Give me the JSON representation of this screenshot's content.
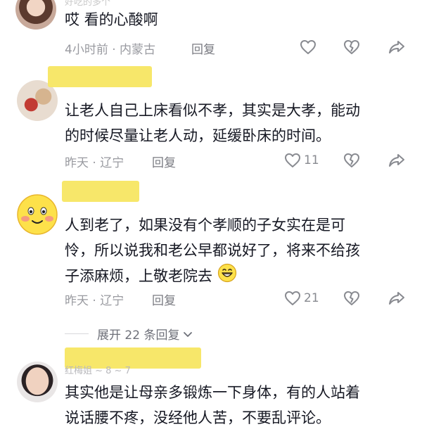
{
  "comments": [
    {
      "name": "好吃的多个",
      "text_lines": [
        "哎  看的心酸啊"
      ],
      "time_location": "4小时前 · 内蒙古",
      "reply_label": "回复",
      "like_count": ""
    },
    {
      "name": "",
      "text_lines": [
        "让老人自己上床看似不孝，其实是大孝，能动",
        "的时候尽量让老人动，延缓卧床的时间。"
      ],
      "time_location": "昨天 · 辽宁",
      "reply_label": "回复",
      "like_count": "11"
    },
    {
      "name": "",
      "text_lines": [
        "人到老了，如果没有个孝顺的子女实在是可",
        "怜，所以说我和老公早都说好了，将来不给孩",
        "子添麻烦，上敬老院去"
      ],
      "time_location": "昨天 · 辽宁",
      "reply_label": "回复",
      "like_count": "21"
    },
    {
      "name": "红梅姐 ~ 8 ~ 7",
      "text_lines": [
        "其实他是让母亲多锻炼一下身体，有的人站着",
        "说话腰不疼，没经他人苦，不要乱评论。"
      ]
    }
  ],
  "expand_replies": {
    "label": "展开 22 条回复"
  },
  "icons": {
    "like": "heart-icon",
    "dislike": "broken-heart-icon",
    "share": "share-arrow-icon",
    "expand": "chevron-down-icon",
    "emoji": "grinning-face-icon"
  },
  "colors": {
    "text": "#161823",
    "meta": "#999aa0",
    "name_highlight": "#f7e76a"
  }
}
